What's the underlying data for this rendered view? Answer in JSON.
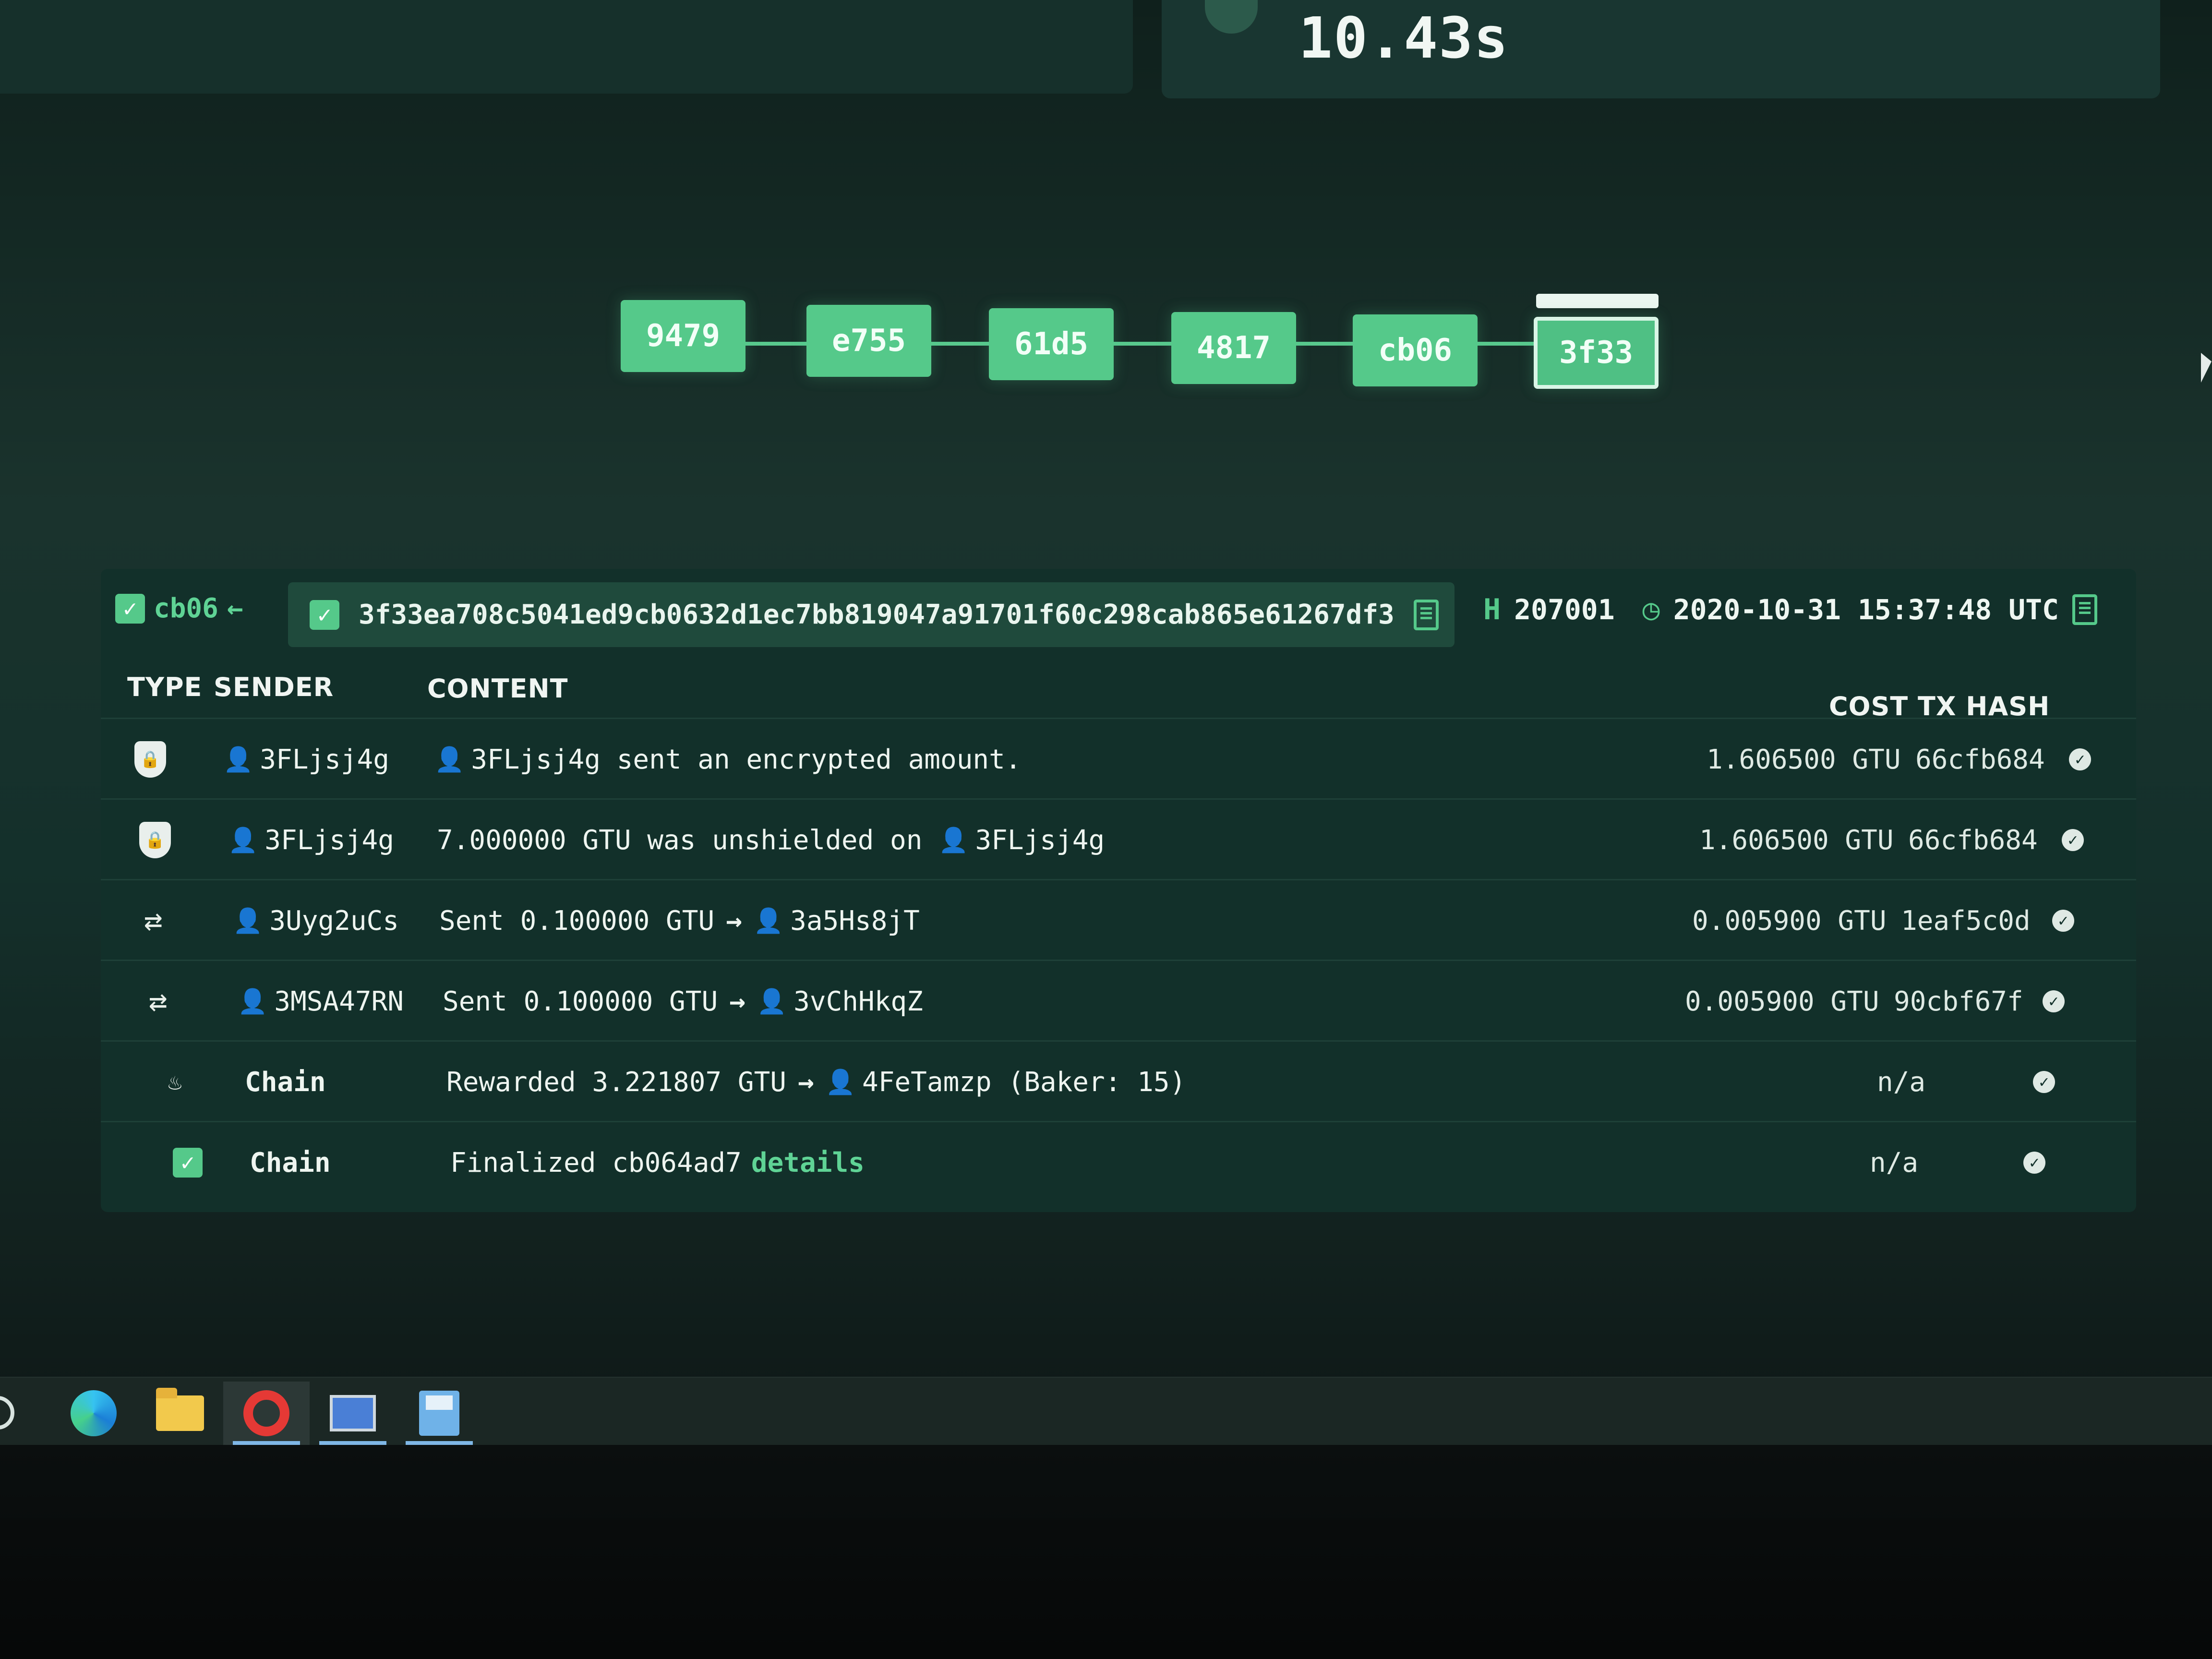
{
  "stats": {
    "time_value": "10.43s"
  },
  "chain": {
    "blocks": [
      "9479",
      "e755",
      "61d5",
      "4817",
      "cb06",
      "3f33"
    ],
    "selected": "3f33"
  },
  "block_detail": {
    "prev_link": "cb06",
    "hash": "3f33ea708c5041ed9cb0632d1ec7bb819047a91701f60c298cab865e61267df3",
    "height": "207001",
    "timestamp": "2020-10-31 15:37:48 UTC"
  },
  "table": {
    "headers": {
      "type": "TYPE",
      "sender": "SENDER",
      "content": "CONTENT",
      "cost": "COST",
      "tx_hash": "TX HASH"
    },
    "rows": [
      {
        "icon": "shield-lock-icon",
        "sender": "3FLjsj4g",
        "content_lead": "",
        "content_user": "3FLjsj4g",
        "content_text": "sent an encrypted amount.",
        "cost": "1.606500 GTU",
        "tx_hash": "66cfb684"
      },
      {
        "icon": "shield-lock-icon",
        "sender": "3FLjsj4g",
        "content_text": "7.000000 GTU was unshielded on",
        "content_user": "3FLjsj4g",
        "cost": "1.606500 GTU",
        "tx_hash": "66cfb684"
      },
      {
        "icon": "transfer-icon",
        "sender": "3Uyg2uCs",
        "content_text": "Sent 0.100000 GTU",
        "content_user": "3a5Hs8jT",
        "cost": "0.005900 GTU",
        "tx_hash": "1eaf5c0d"
      },
      {
        "icon": "transfer-icon",
        "sender": "3MSA47RN",
        "content_text": "Sent 0.100000 GTU",
        "content_user": "3vChHkqZ",
        "cost": "0.005900 GTU",
        "tx_hash": "90cbf67f"
      },
      {
        "icon": "baker-icon",
        "sender": "Chain",
        "content_text": "Rewarded 3.221807 GTU",
        "content_user": "4FeTamzp",
        "content_suffix": "(Baker: 15)",
        "cost": "n/a",
        "tx_hash": ""
      },
      {
        "icon": "finalized-check-icon",
        "sender": "Chain",
        "content_text": "Finalized cb064ad7",
        "content_link": "details",
        "cost": "n/a",
        "tx_hash": ""
      }
    ]
  },
  "taskbar": {
    "items": [
      "search-icon",
      "edge-icon",
      "file-explorer-icon",
      "opera-icon",
      "remote-desktop-icon",
      "save-icon"
    ]
  }
}
